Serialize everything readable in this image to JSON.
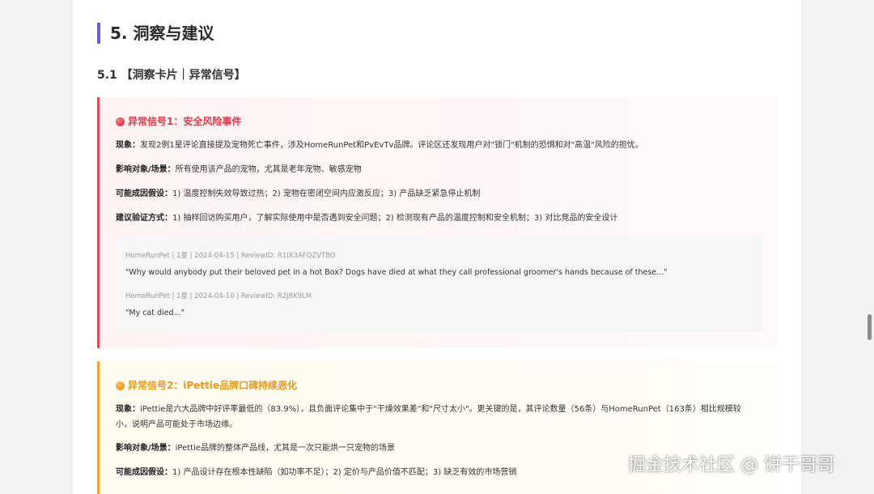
{
  "section": {
    "title": "5. 洞察与建议"
  },
  "subsection": {
    "title": "5.1 【洞察卡片｜异常信号】"
  },
  "cards": [
    {
      "title": "异常信号1：安全风险事件",
      "icon": "red-circle-icon",
      "rows": [
        {
          "label": "现象：",
          "text": "发现2例1星评论直接提及宠物死亡事件，涉及HomeRunPet和PvEvTv品牌。评论区还发现用户对\"锁门\"机制的恐惧和对\"高温\"风险的担忧。"
        },
        {
          "label": "影响对象/场景：",
          "text": "所有使用该产品的宠物，尤其是老年宠物、敏感宠物"
        },
        {
          "label": "可能成因假设：",
          "text": "1) 温度控制失效导致过热；2) 宠物在密闭空间内应激反应；3) 产品缺乏紧急停止机制"
        },
        {
          "label": "建议验证方式：",
          "text": "1) 抽样回访购买用户，了解实际使用中是否遇到安全问题；2) 检测现有产品的温度控制和安全机制；3) 对比竞品的安全设计"
        }
      ],
      "quotes": [
        {
          "meta": "HomeRunPet | 1星 | 2024-04-15 | ReviewID: R1IX3AFQZVTBO",
          "text": "\"Why would anybody put their beloved pet in a hot Box? Dogs have died at what they call professional groomer's hands because of these...\""
        },
        {
          "meta": "HomeRunPet | 1星 | 2024-04-10 | ReviewID: R2J8K9LM",
          "text": "\"My cat died...\""
        }
      ]
    },
    {
      "title": "异常信号2：iPettie品牌口碑持续恶化",
      "icon": "orange-circle-icon",
      "rows": [
        {
          "label": "现象：",
          "text": "iPettie是六大品牌中好评率最低的（83.9%），且负面评论集中于\"干燥效果差\"和\"尺寸太小\"。更关键的是，其评论数量（56条）与HomeRunPet（163条）相比规模较小，说明产品可能处于市场边缘。"
        },
        {
          "label": "影响对象/场景：",
          "text": "iPettie品牌的整体产品线，尤其是一次只能烘一只宠物的场景"
        },
        {
          "label": "可能成因假设：",
          "text": "1) 产品设计存在根本性缺陷（如功率不足）；2) 定价与产品价值不匹配；3) 缺乏有效的市场营销"
        }
      ]
    }
  ],
  "watermark": {
    "text": "掘金技术社区 @ 饼干哥哥"
  }
}
